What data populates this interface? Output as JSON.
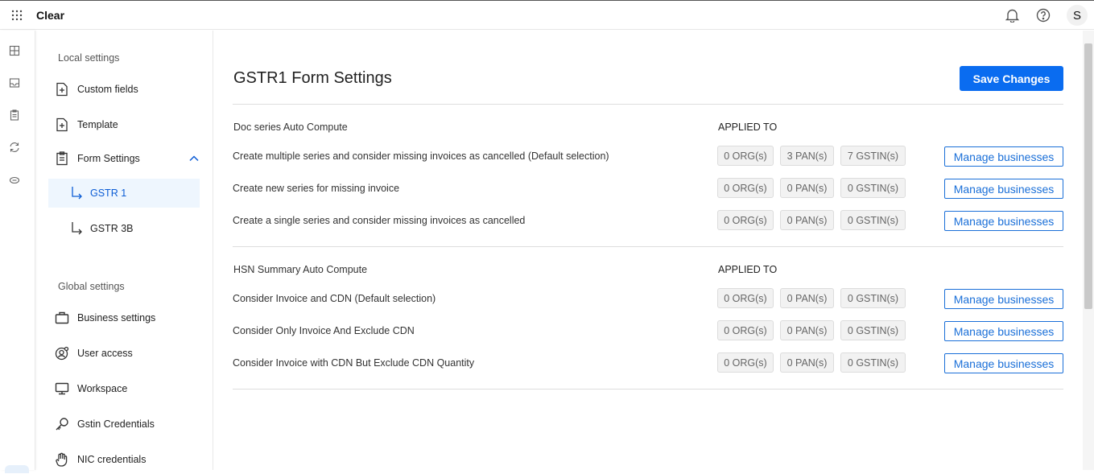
{
  "app": {
    "title": "Clear",
    "avatar_initial": "S"
  },
  "sidebar": {
    "local_label": "Local settings",
    "global_label": "Global settings",
    "local_items": [
      {
        "label": "Custom fields",
        "icon": "file-plus-icon"
      },
      {
        "label": "Template",
        "icon": "file-plus-icon"
      },
      {
        "label": "Form Settings",
        "icon": "clipboard-icon",
        "expanded": true
      },
      {
        "label": "GSTR 1",
        "icon": "sub-arrow-icon",
        "active": true
      },
      {
        "label": "GSTR 3B",
        "icon": "sub-arrow-icon"
      }
    ],
    "global_items": [
      {
        "label": "Business settings",
        "icon": "briefcase-icon"
      },
      {
        "label": "User access",
        "icon": "user-gear-icon"
      },
      {
        "label": "Workspace",
        "icon": "monitor-icon"
      },
      {
        "label": "Gstin Credentials",
        "icon": "key-icon"
      },
      {
        "label": "NIC credentials",
        "icon": "hand-icon"
      }
    ]
  },
  "main": {
    "title": "GSTR1 Form Settings",
    "save_label": "Save Changes",
    "groups": [
      {
        "title": "Doc series Auto Compute",
        "applied_label": "APPLIED TO",
        "rows": [
          {
            "label": "Create multiple series and consider missing invoices as cancelled (Default selection)",
            "org": "0 ORG(s)",
            "pan": "3 PAN(s)",
            "gstin": "7 GSTIN(s)",
            "action": "Manage businesses"
          },
          {
            "label": "Create new series for missing invoice",
            "org": "0 ORG(s)",
            "pan": "0 PAN(s)",
            "gstin": "0 GSTIN(s)",
            "action": "Manage businesses"
          },
          {
            "label": "Create a single series and consider missing invoices as cancelled",
            "org": "0 ORG(s)",
            "pan": "0 PAN(s)",
            "gstin": "0 GSTIN(s)",
            "action": "Manage businesses"
          }
        ]
      },
      {
        "title": "HSN Summary Auto Compute",
        "applied_label": "APPLIED TO",
        "rows": [
          {
            "label": "Consider Invoice and CDN (Default selection)",
            "org": "0 ORG(s)",
            "pan": "0 PAN(s)",
            "gstin": "0 GSTIN(s)",
            "action": "Manage businesses"
          },
          {
            "label": "Consider Only Invoice And Exclude CDN",
            "org": "0 ORG(s)",
            "pan": "0 PAN(s)",
            "gstin": "0 GSTIN(s)",
            "action": "Manage businesses"
          },
          {
            "label": "Consider Invoice with CDN But Exclude CDN Quantity",
            "org": "0 ORG(s)",
            "pan": "0 PAN(s)",
            "gstin": "0 GSTIN(s)",
            "action": "Manage businesses"
          }
        ]
      }
    ]
  },
  "colors": {
    "primary": "#0a6cf0",
    "active_bg": "#eef6fe",
    "active_text": "#0b5cd5",
    "chip_bg": "#f2f2f2"
  }
}
